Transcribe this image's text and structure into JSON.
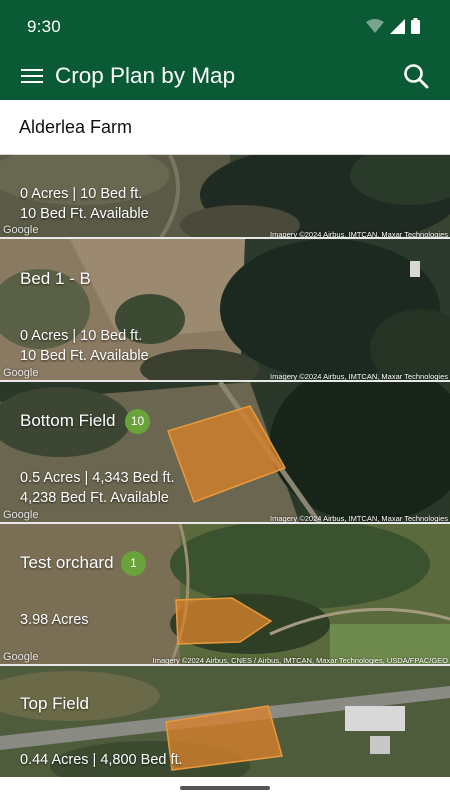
{
  "status_bar": {
    "time": "9:30",
    "icons": [
      "wifi-icon",
      "cell-signal-icon",
      "battery-icon"
    ]
  },
  "app_bar": {
    "title": "Crop Plan by Map",
    "menu_icon": "menu-icon",
    "search_icon": "search-icon"
  },
  "farm": {
    "name": "Alderlea Farm"
  },
  "cards": [
    {
      "title": "",
      "badge": "",
      "line1": "0 Acres | 10 Bed ft.",
      "line2": "10 Bed Ft. Available",
      "attribution": "Imagery ©2024 Airbus, IMTCAN, Maxar Technologies"
    },
    {
      "title": "Bed 1 - B",
      "badge": "",
      "line1": "0 Acres | 10 Bed ft.",
      "line2": "10 Bed Ft. Available",
      "attribution": "Imagery ©2024 Airbus, IMTCAN, Maxar Technologies"
    },
    {
      "title": "Bottom Field",
      "badge": "10",
      "line1": "0.5 Acres | 4,343 Bed ft.",
      "line2": "4,238 Bed Ft. Available",
      "attribution": "Imagery ©2024 Airbus, IMTCAN, Maxar Technologies"
    },
    {
      "title": "Test orchard",
      "badge": "1",
      "line1": "3.98  Acres",
      "line2": "",
      "attribution": "Imagery ©2024 Airbus, CNES / Airbus, IMTCAN, Maxar Technologies, USDA/FPAC/GEO"
    },
    {
      "title": "Top Field",
      "badge": "",
      "line1": "0.44 Acres | 4,800 Bed ft.",
      "line2": "",
      "attribution": ""
    }
  ],
  "map_watermark": "Google",
  "colors": {
    "app_bar": "#0b5a36",
    "badge": "#6aa33a",
    "field_overlay": "#d9822b"
  }
}
